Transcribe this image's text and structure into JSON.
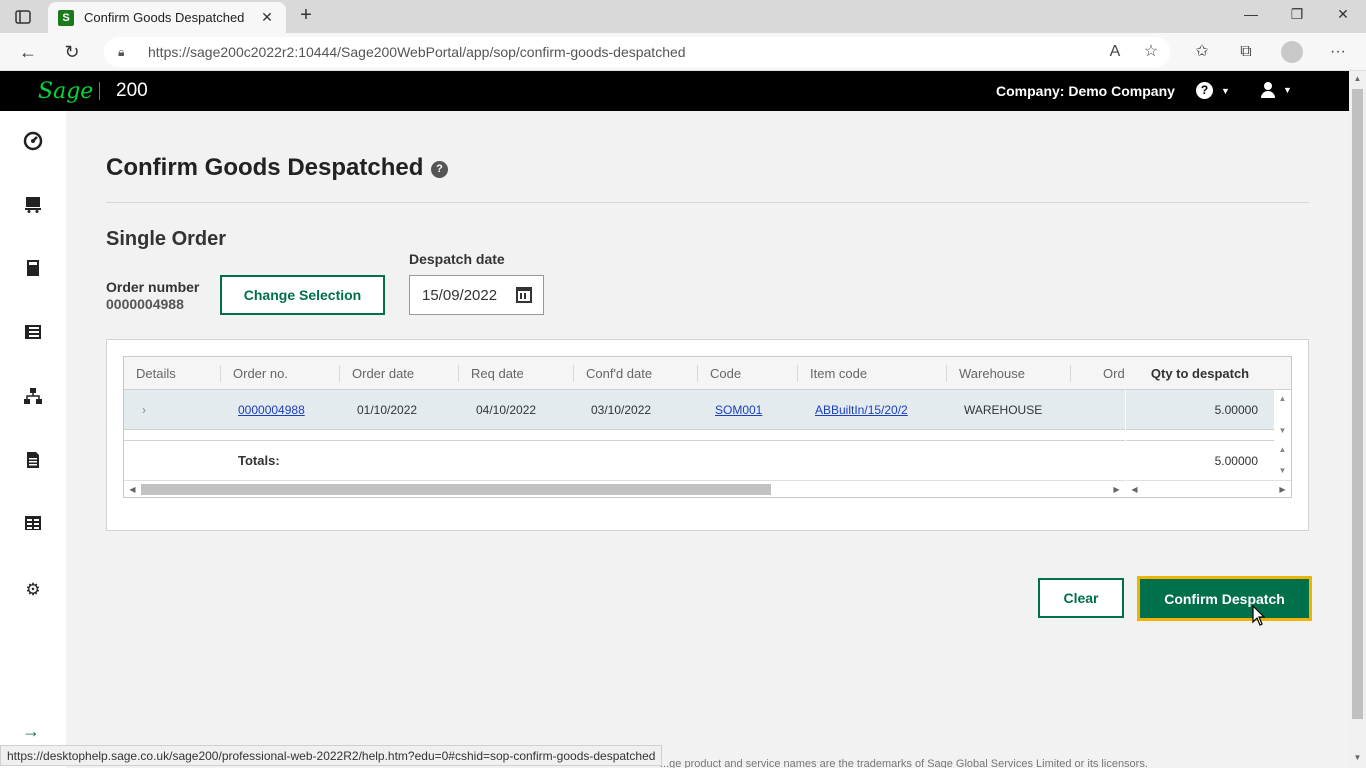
{
  "browser": {
    "tab_title": "Confirm Goods Despatched",
    "tab_favicon": "S",
    "url": "https://sage200c2022r2:10444/Sage200WebPortal/app/sop/confirm-goods-despatched",
    "status_url": "https://desktophelp.sage.co.uk/sage200/professional-web-2022R2/help.htm?edu=0#cshid=sop-confirm-goods-despatched"
  },
  "header": {
    "logo": "Sage",
    "product": "200",
    "company": "Company: Demo Company"
  },
  "sidebar": {
    "icons": [
      "dashboard-icon",
      "cart-icon",
      "book-icon",
      "invoice-icon",
      "org-chart-icon",
      "document-icon",
      "table-icon",
      "gear-icon",
      "expand-arrow-icon"
    ]
  },
  "page": {
    "title": "Confirm Goods Despatched",
    "section": "Single Order",
    "order_number_label": "Order number",
    "order_number": "0000004988",
    "change_selection": "Change Selection",
    "despatch_date_label": "Despatch date",
    "despatch_date": "15/09/2022"
  },
  "grid": {
    "columns": [
      "Details",
      "Order no.",
      "Order date",
      "Req date",
      "Conf'd date",
      "Code",
      "Item code",
      "Warehouse",
      "Ord"
    ],
    "frozen_column": "Qty to despatch",
    "rows": [
      {
        "order_no": "0000004988",
        "order_date": "01/10/2022",
        "req_date": "04/10/2022",
        "confd_date": "03/10/2022",
        "code": "SOM001",
        "item_code": "ABBuiltIn/15/20/2",
        "warehouse": "WAREHOUSE",
        "qty": "5.00000"
      }
    ],
    "totals_label": "Totals:",
    "totals_qty": "5.00000"
  },
  "actions": {
    "clear": "Clear",
    "confirm": "Confirm Despatch"
  },
  "footer": {
    "text": "...ge product and service names are the trademarks of Sage Global Services Limited or its licensors."
  },
  "colors": {
    "brand_green": "#00704a",
    "logo_green": "#00d639",
    "focus_yellow": "#f0b400"
  }
}
